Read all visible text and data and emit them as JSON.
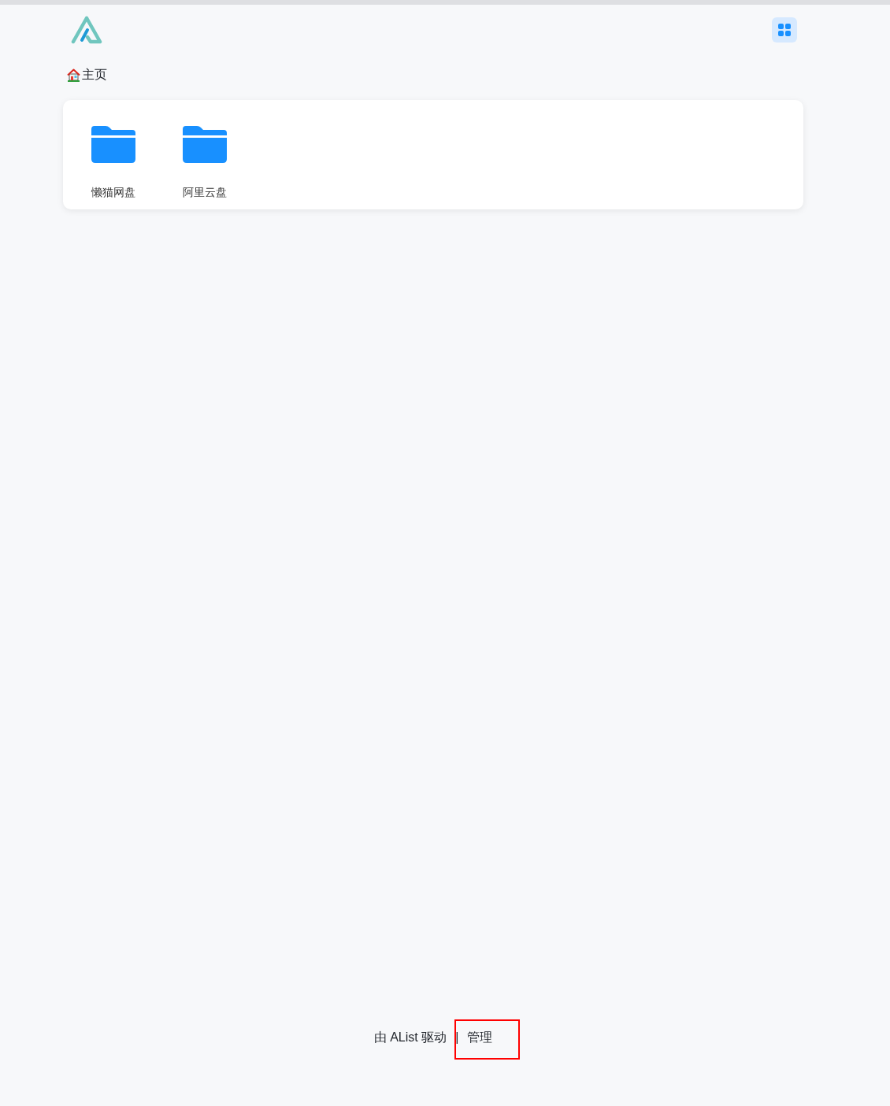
{
  "breadcrumb": {
    "label": "主页"
  },
  "folders": [
    {
      "name": "懒猫网盘"
    },
    {
      "name": "阿里云盘"
    }
  ],
  "footer": {
    "powered_by": "由 AList 驱动",
    "separator": "|",
    "manage_link": {
      "label": "管理",
      "highlighted": true
    }
  }
}
